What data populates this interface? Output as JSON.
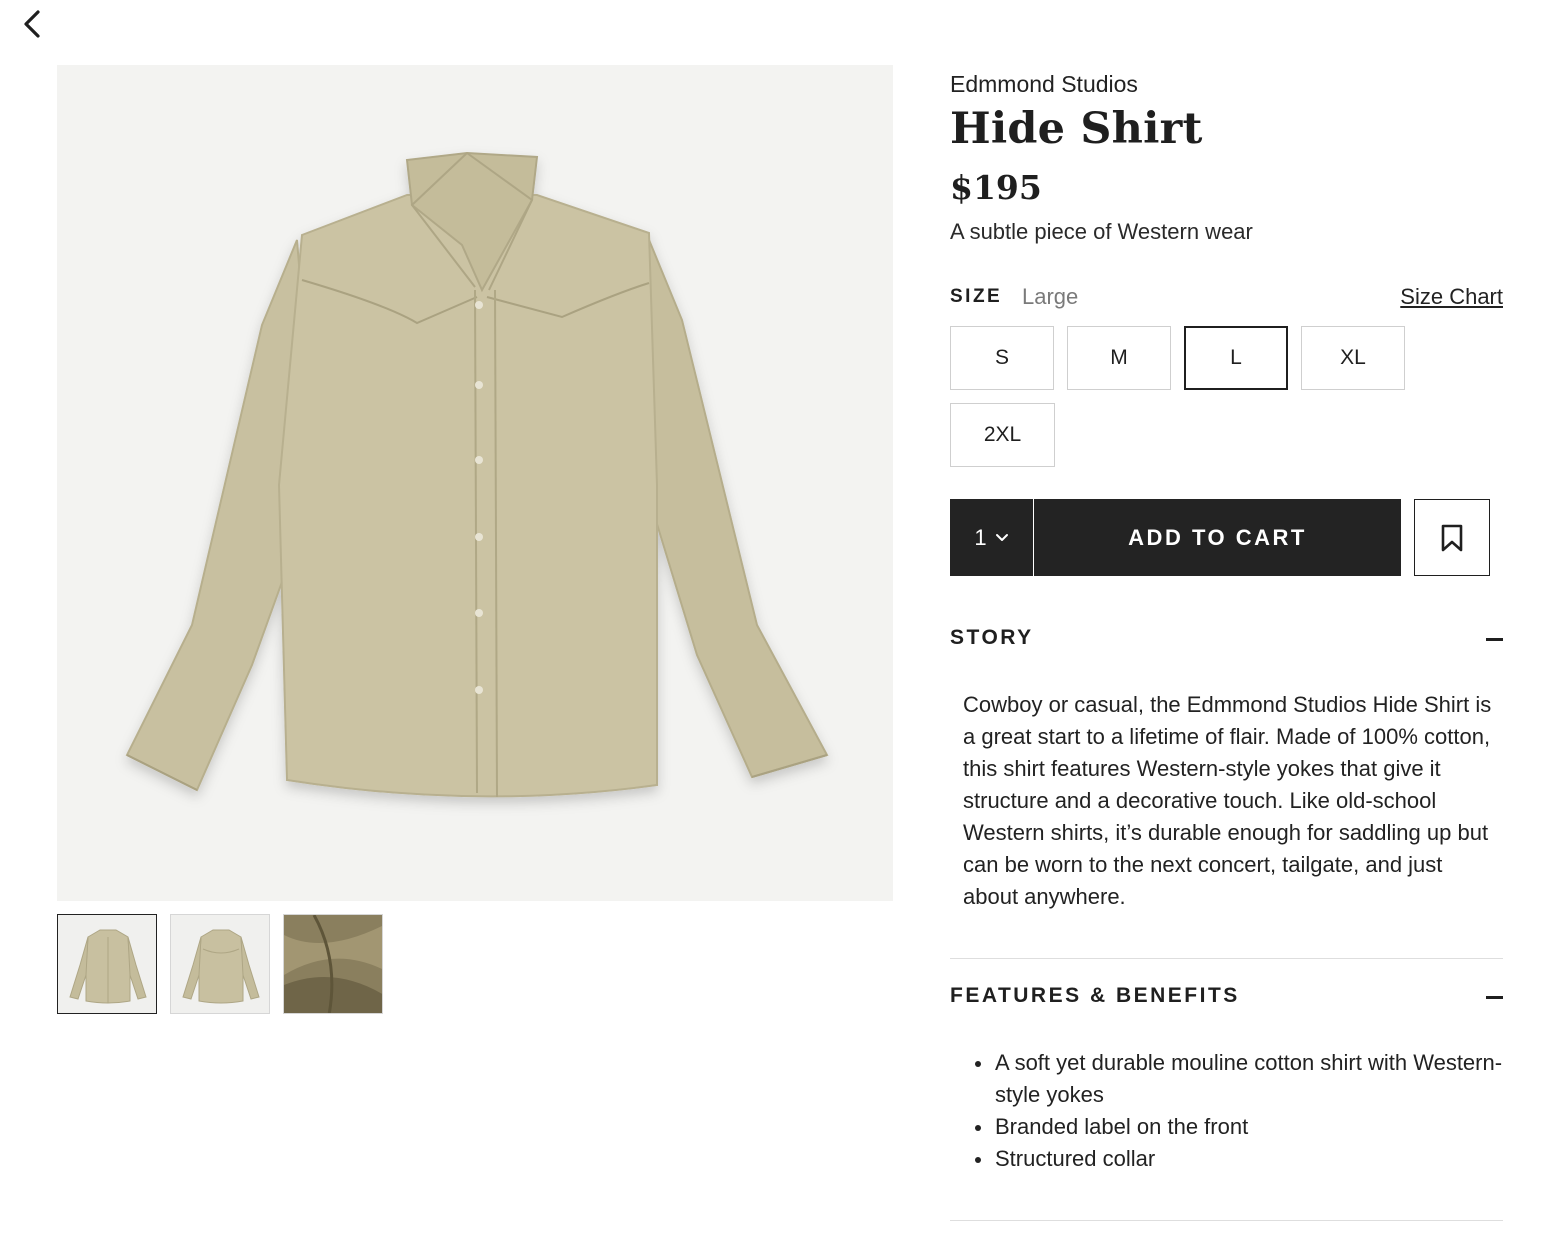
{
  "product": {
    "brand": "Edmmond Studios",
    "title": "Hide Shirt",
    "price": "$195",
    "tagline": "A subtle piece of Western wear"
  },
  "size": {
    "label": "SIZE",
    "selected_value": "Large",
    "chart_link": "Size Chart",
    "options": [
      "S",
      "M",
      "L",
      "XL",
      "2XL"
    ],
    "selected_option": "L"
  },
  "cart": {
    "quantity": "1",
    "add_label": "ADD TO CART"
  },
  "story": {
    "heading": "STORY",
    "text": "Cowboy or casual, the Edmmond Studios Hide Shirt is a great start to a lifetime of flair. Made of 100% cotton, this shirt features Western-style yokes that give it structure and a decorative touch. Like old-school Western shirts, it’s durable enough for saddling up but can be worn to the next concert, tailgate, and just about anywhere."
  },
  "features": {
    "heading": "FEATURES & BENEFITS",
    "items": [
      "A soft yet durable mouline cotton shirt with Western-style yokes",
      "Branded label on the front",
      "Structured collar"
    ]
  },
  "colors": {
    "text": "#1f1f1f",
    "button_bg": "#232323",
    "shirt": "#c9c2a0",
    "image_bg": "#f3f3f1",
    "muted": "#7a7a7a"
  },
  "icons": {
    "back": "chevron-left-icon",
    "quantity": "chevron-down-icon",
    "save": "bookmark-icon",
    "accordion": "minus-icon"
  }
}
